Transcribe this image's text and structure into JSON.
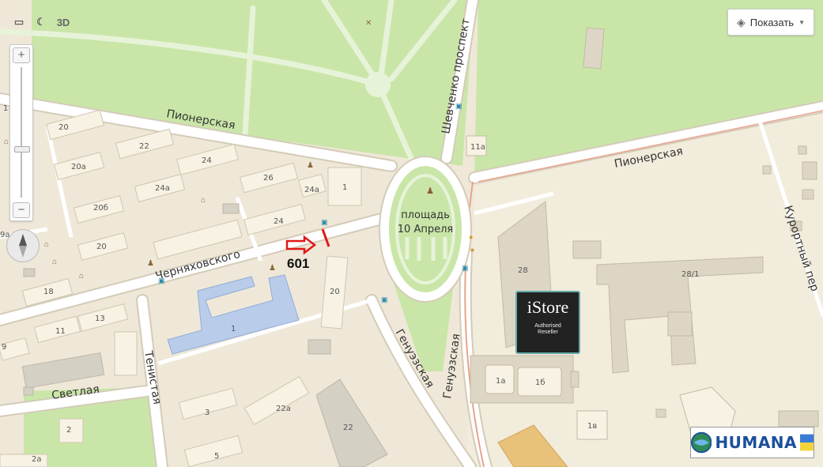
{
  "toolbar": {
    "ruler_icon": "ruler-icon",
    "traffic_icon": "traffic-icon",
    "mode_3d": "3D"
  },
  "show_button": {
    "label": "Показать"
  },
  "zoom": {
    "plus": "+",
    "minus": "−"
  },
  "streets": {
    "pionerskaya_left": "Пионерская",
    "pionerskaya_right": "Пионерская",
    "shevchenko": "Шевченко проспект",
    "chernyakhovskogo": "Черняховского",
    "genuezskaya_left": "Генуэзская",
    "genuezskaya_right": "Генуэзская",
    "svetlaya": "Светлая",
    "tenistaya": "Тенистая",
    "kurortny": "Курортный пер"
  },
  "square": {
    "line1": "площадь",
    "line2": "10 Апреля"
  },
  "marker": {
    "label": "601",
    "arrow_color": "#e01818"
  },
  "buildings": {
    "b20": "20",
    "b22": "22",
    "b20a": "20а",
    "b24": "24",
    "b24a": "24а",
    "b26": "26",
    "b1_top": "1",
    "b24_mid": "24",
    "b20b": "20б",
    "b20_low": "20",
    "b18": "18",
    "b11": "11",
    "b13": "13",
    "b9": "9",
    "b1_blue": "1",
    "b20_center": "20",
    "b11a": "11а",
    "b28": "28",
    "b28_1": "28/1",
    "b1a": "1а",
    "b1b": "1б",
    "b1v": "1в",
    "b3": "3",
    "b22a": "22а",
    "b22_low": "22",
    "b2": "2",
    "b5": "5",
    "b2a": "2а",
    "b1_left": "1",
    "b9a": "9а"
  },
  "istore": {
    "brand": "iStore",
    "line1": "Authorised",
    "line2": "Reseller"
  },
  "humana": {
    "brand": "HUMANA"
  },
  "colors": {
    "park": "#c9e6a8",
    "land": "#efe8d8",
    "road": "#ffffff",
    "school": "#b9cdeb"
  }
}
